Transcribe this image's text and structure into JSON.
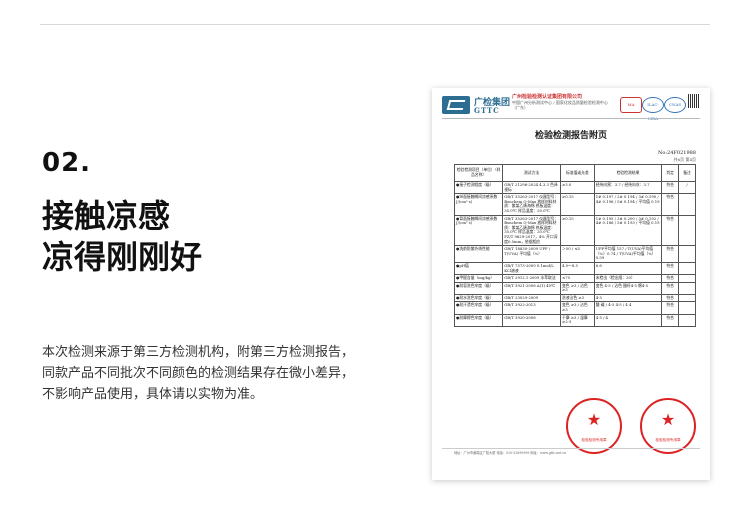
{
  "section": {
    "number": "02.",
    "title_line1": "接触凉感",
    "title_line2": "凉得刚刚好"
  },
  "description": [
    "本次检测来源于第三方检测机构，附第三方检测报告，",
    "同款产品不同批次不同颜色的检测结果存在微小差异，",
    "不影响产品使用，具体请以实物为准。"
  ],
  "report": {
    "logo_cn": "广检集团",
    "logo_en": "GTTC",
    "institute_name": "广州检验检测认证集团有限公司",
    "institute_note": "中国广州分析测试中心 / 国家化妆品质量检验检测中心（广东）",
    "cert_ma": "MA",
    "cert_ilac": "ILAC-MRA",
    "cert_cnas": "CNAS",
    "title": "检验检测报告附页",
    "report_no": "No:24F021988",
    "page_info": "共6页  第4页",
    "headers": [
      "检验检测项目（单位）（样品名称）",
      "测试方法",
      "标准值或允差",
      "检验检测结果",
      "判定",
      "备注"
    ],
    "rows": [
      {
        "item": "●接子检测程度（级）",
        "method": "GB/T 21296-2024 4.3.3 色泽视标",
        "std": "≥3.0",
        "result": "经纬向黑：3.7 / 经纬向灰：3.7",
        "judge": "符合",
        "note": "/"
      },
      {
        "item": "●纵面接触瞬间凉感系数 J/(cm²·s)",
        "method": "GB/T 35263-2017 仪器型号：Bonchem Q-Max 放样材料材质：紫某乙烯海绵 热板温度：35.0℃ 样品温度：20.0℃",
        "std": "≥0.15",
        "result": "1# 0.197 / 2# 0.194 / 3# 0.190 / 4# 0.196 / 5# 0.194 / 平均值 0.19",
        "judge": "符合",
        "note": ""
      },
      {
        "item": "●背面接触瞬间凉感系数 J/(cm²·s)",
        "method": "GB/T 35263-2017 仪器型号：Bonchem Q-Max 放样材料材质：紫某乙烯海绵 热板温度：35.0℃ 样品温度：20.0℃ FZ/T 9629-2017，4% 开口深度0.5mm，依据相应",
        "std": "≥0.15",
        "result": "1# 0.195 / 2# 0.200 / 3# 0.192 / 4# 0.186 / 5# 0.193 / 平均值 0.19",
        "judge": "符合",
        "note": ""
      },
      {
        "item": "●洗前防紫外线性能",
        "method": "GB/T 18830-2009 UPF / T(UVA) 平均值（%）",
        "std": "＞50 / ≤5",
        "result": "UPF平均值 157 / T(UVA)平均值（%）0.74 / T(UVA)平均值（%）0.59",
        "judge": "符合",
        "note": ""
      },
      {
        "item": "●pH值",
        "method": "GB/T 7573-2009 0.1mol/L KCl溶液",
        "std": "4.0～8.5",
        "result": "6.6",
        "judge": "符合",
        "note": ""
      },
      {
        "item": "●甲醛含量（mg/kg）",
        "method": "GB/T 2912.1-2009 水萃取法",
        "std": "≤75",
        "result": "未检出（检出限：20）",
        "judge": "符合",
        "note": ""
      },
      {
        "item": "●耐皂洗色牢度（级）",
        "method": "GB/T 3921-2008 A(1) 40℃",
        "std": "变色 ≥3 / 沾色 ≥3",
        "result": "变色 4-5 / 沾色 醋纤4-5 棉4-5",
        "judge": "符合",
        "note": ""
      },
      {
        "item": "●耐水洗色牢度（级）",
        "method": "GB/T 23029-2009",
        "std": "洗液沾色 ≥3",
        "result": "4-5",
        "judge": "符合",
        "note": ""
      },
      {
        "item": "●耐汗渍色牢度（级）",
        "method": "GB/T 3922-2013",
        "std": "变色 ≥3 / 沾色 ≥3",
        "result": "酸 碱 / 4-5 4-5 / 4 4",
        "judge": "符合",
        "note": ""
      },
      {
        "item": "●耐摩擦色牢度（级）",
        "method": "GB/T 3920-2008",
        "std": "干摩 ≥3 / 湿摩 ≥2-3",
        "result": "4-5 / 4",
        "judge": "符合",
        "note": ""
      }
    ],
    "stamp1_label": "检验检测专用章",
    "stamp2_label": "检验检测专用章",
    "footer": "地址：广州市番禺区广检大厦  电话：020-32899999  网址：www.gttc.net.cn"
  }
}
